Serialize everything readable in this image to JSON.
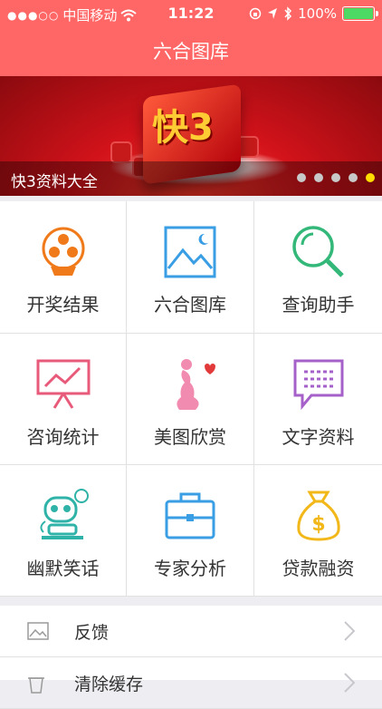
{
  "status": {
    "carrier": "中国移动",
    "time": "11:22",
    "battery": "100%",
    "signal_dots": "●●●○○"
  },
  "nav": {
    "title": "六合图库"
  },
  "banner": {
    "caption": "快3资料大全",
    "cube_text": "快3",
    "page_count": 5,
    "active_page": 5
  },
  "grid": [
    {
      "label": "开奖结果",
      "icon": "lottery-ball-icon"
    },
    {
      "label": "六合图库",
      "icon": "picture-icon"
    },
    {
      "label": "查询助手",
      "icon": "search-icon"
    },
    {
      "label": "咨询统计",
      "icon": "statistics-board-icon"
    },
    {
      "label": "美图欣赏",
      "icon": "woman-silhouette-icon"
    },
    {
      "label": "文字资料",
      "icon": "text-chat-icon"
    },
    {
      "label": "幽默笑话",
      "icon": "robot-icon"
    },
    {
      "label": "专家分析",
      "icon": "briefcase-icon"
    },
    {
      "label": "贷款融资",
      "icon": "money-bag-icon"
    }
  ],
  "list": [
    {
      "label": "反馈",
      "icon": "image-icon"
    },
    {
      "label": "清除缓存",
      "icon": "trash-icon"
    }
  ],
  "colors": {
    "primary": "#ff6666",
    "active_dot": "#ffde00",
    "battery": "#4cd964"
  }
}
